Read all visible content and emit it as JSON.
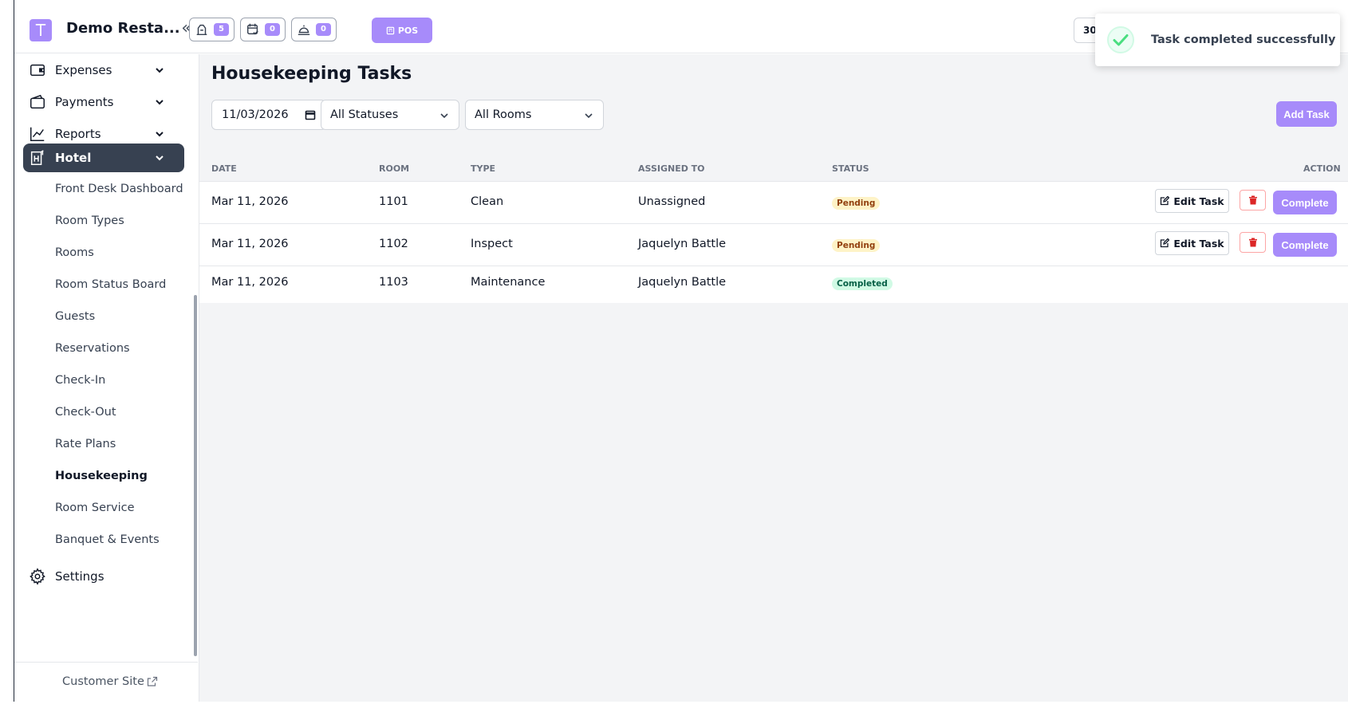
{
  "header": {
    "brand_initial": "T",
    "brand_name": "Demo Resta...",
    "collapse_glyph": "«",
    "badges": [
      {
        "icon": "kitchen-icon",
        "count": "5"
      },
      {
        "icon": "calendar-check-icon",
        "count": "0"
      },
      {
        "icon": "room-service-icon",
        "count": "0"
      }
    ],
    "pos_label": "POS",
    "right_chip_partial": "30"
  },
  "toast": {
    "message": "Task completed successfully",
    "icon": "check-circle-icon"
  },
  "sidebar": {
    "items": [
      {
        "label": "Expenses",
        "icon": "wallet-icon"
      },
      {
        "label": "Payments",
        "icon": "payments-icon"
      },
      {
        "label": "Reports",
        "icon": "chart-line-icon"
      },
      {
        "label": "Hotel",
        "icon": "hotel-icon"
      }
    ],
    "hotel_sub": [
      "Front Desk Dashboard",
      "Room Types",
      "Rooms",
      "Room Status Board",
      "Guests",
      "Reservations",
      "Check-In",
      "Check-Out",
      "Rate Plans",
      "Housekeeping",
      "Room Service",
      "Banquet & Events"
    ],
    "settings_label": "Settings",
    "customer_site_label": "Customer Site"
  },
  "main": {
    "title": "Housekeeping Tasks",
    "filters": {
      "date_value": "11/03/2026",
      "status_value": "All Statuses",
      "room_value": "All Rooms"
    },
    "add_task_label": "Add Task",
    "columns": [
      "Date",
      "Room",
      "Type",
      "Assigned To",
      "Status",
      "Action"
    ],
    "rows": [
      {
        "date": "Mar 11, 2026",
        "room": "1101",
        "type": "Clean",
        "assigned": "Unassigned",
        "status": "Pending"
      },
      {
        "date": "Mar 11, 2026",
        "room": "1102",
        "type": "Inspect",
        "assigned": "Jaquelyn Battle",
        "status": "Pending"
      },
      {
        "date": "Mar 11, 2026",
        "room": "1103",
        "type": "Maintenance",
        "assigned": "Jaquelyn Battle",
        "status": "Completed"
      }
    ],
    "edit_label": "Edit Task",
    "complete_label": "Complete"
  },
  "colors": {
    "accent": "#a78bfa",
    "active_nav": "#374151",
    "pending_bg": "#fef3c7",
    "completed_bg": "#d1fae5",
    "danger": "#dc2626"
  }
}
